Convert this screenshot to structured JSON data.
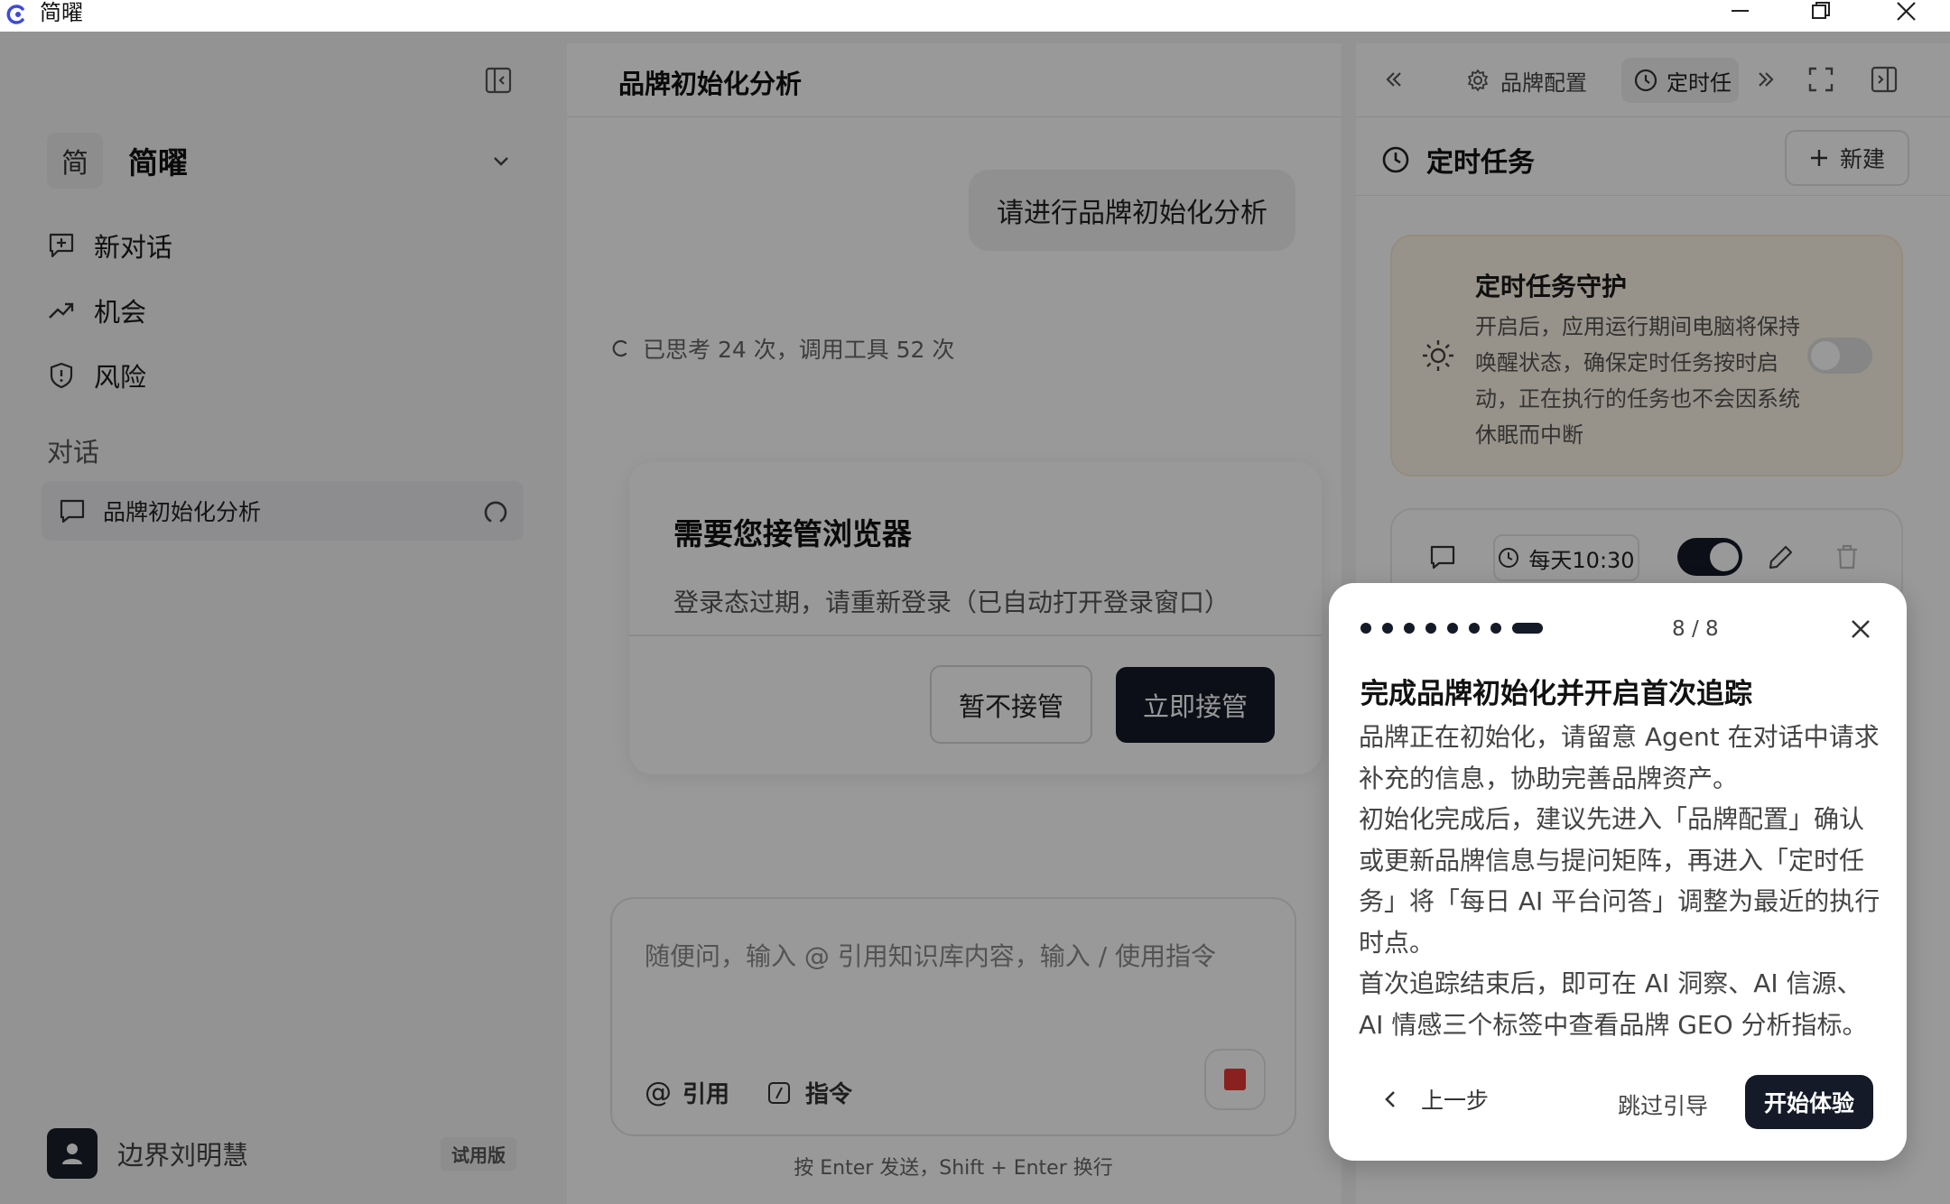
{
  "app": {
    "title": "简曜"
  },
  "sidebar": {
    "brand_avatar": "简",
    "brand_name": "简曜",
    "nav": [
      {
        "label": "新对话",
        "icon": "new-chat-icon"
      },
      {
        "label": "机会",
        "icon": "trend-up-icon"
      },
      {
        "label": "风险",
        "icon": "shield-alert-icon"
      }
    ],
    "section_label": "对话",
    "conversations": [
      {
        "label": "品牌初始化分析",
        "status": "loading"
      }
    ],
    "user": {
      "name": "边界刘明慧",
      "plan": "试用版"
    }
  },
  "chat": {
    "title": "品牌初始化分析",
    "user_message": "请进行品牌初始化分析",
    "thinking_status": "已思考 24 次，调用工具 52 次",
    "input_placeholder": "随便问，输入 @ 引用知识库内容，输入 / 使用指令",
    "tool_cite": "引用",
    "tool_command": "指令",
    "hint": "按 Enter 发送，Shift + Enter 换行"
  },
  "dialog": {
    "title": "需要您接管浏览器",
    "description": "登录态过期，请重新登录（已自动打开登录窗口）",
    "cancel_label": "暂不接管",
    "confirm_label": "立即接管"
  },
  "right_panel": {
    "tabs": [
      {
        "label": "品牌配置",
        "icon": "gear-icon",
        "active": false
      },
      {
        "label": "定时任",
        "icon": "clock-icon",
        "active": true
      }
    ],
    "header": "定时任务",
    "new_button": "新建",
    "guard": {
      "title": "定时任务守护",
      "text": "开启后，应用运行期间电脑将保持唤醒状态，确保定时任务按时启动，正在执行的任务也不会因系统休眠而中断",
      "enabled": false
    },
    "task": {
      "schedule": "每天10:30",
      "enabled": true
    }
  },
  "tour": {
    "step_current": 8,
    "step_total": 8,
    "step_label": "8 / 8",
    "title": "完成品牌初始化并开启首次追踪",
    "paragraphs": [
      "品牌正在初始化，请留意 Agent 在对话中请求补充的信息，协助完善品牌资产。",
      "初始化完成后，建议先进入「品牌配置」确认或更新品牌信息与提问矩阵，再进入「定时任务」将「每日 AI 平台问答」调整为最近的执行时点。",
      "首次追踪结束后，即可在 AI 洞察、AI 信源、AI 情感三个标签中查看品牌 GEO 分析指标。"
    ],
    "prev_label": "上一步",
    "skip_label": "跳过引导",
    "start_label": "开始体验"
  },
  "colors": {
    "primary_dark": "#141a27",
    "stop_red": "#e53935",
    "guard_bg": "#fdf5e6"
  }
}
